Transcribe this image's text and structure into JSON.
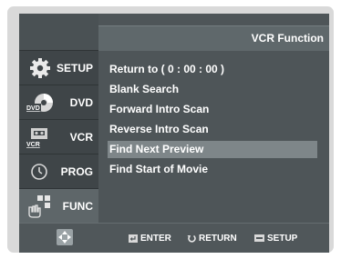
{
  "header": {
    "title": "VCR Function"
  },
  "sidebar": {
    "items": [
      {
        "label": "SETUP",
        "icon": "gear-icon"
      },
      {
        "label": "DVD",
        "icon": "dvd-disc-icon",
        "icon_text": "DVD"
      },
      {
        "label": "VCR",
        "icon": "vcr-cassette-icon",
        "icon_text": "VCR"
      },
      {
        "label": "PROG",
        "icon": "clock-icon"
      },
      {
        "label": "FUNC",
        "icon": "hand-grid-icon",
        "active": true
      }
    ]
  },
  "menu": {
    "items": [
      {
        "label": "Return to ( 0 : 00 : 00 )"
      },
      {
        "label": "Blank Search"
      },
      {
        "label": "Forward Intro Scan"
      },
      {
        "label": "Reverse Intro Scan"
      },
      {
        "label": "Find Next Preview",
        "selected": true
      },
      {
        "label": "Find Start of Movie"
      }
    ]
  },
  "footer": {
    "nav_icon": "dpad-icon",
    "enter_label": "ENTER",
    "return_label": "RETURN",
    "setup_label": "SETUP"
  },
  "colors": {
    "screen_bg": "#4e5558",
    "sidebar_bg": "#3f4548",
    "selected_bg": "#7e8689",
    "text": "#ffffff"
  }
}
